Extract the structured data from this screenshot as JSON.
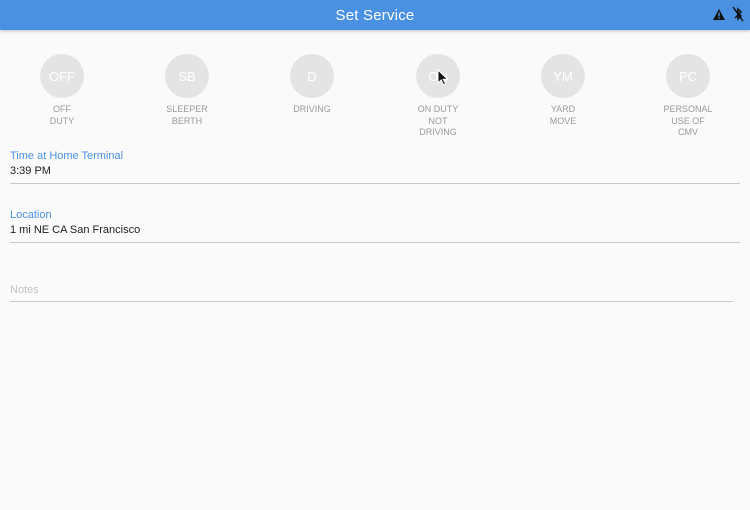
{
  "header": {
    "title": "Set Service"
  },
  "statuses": [
    {
      "code": "OFF",
      "label": "OFF\nDUTY"
    },
    {
      "code": "SB",
      "label": "SLEEPER\nBERTH"
    },
    {
      "code": "D",
      "label": "DRIVING"
    },
    {
      "code": "ON",
      "label": "ON DUTY\nNOT\nDRIVING"
    },
    {
      "code": "YM",
      "label": "YARD\nMOVE"
    },
    {
      "code": "PC",
      "label": "PERSONAL\nUSE OF\nCMV"
    }
  ],
  "form": {
    "time_label": "Time at Home Terminal",
    "time_value": "3:39 PM",
    "location_label": "Location",
    "location_value": "1 mi NE CA San Francisco",
    "notes_placeholder": "Notes"
  },
  "icons": {
    "warning": "warning-icon",
    "bluetooth": "bluetooth-off-icon"
  },
  "colors": {
    "header": "#4b91e2",
    "label_accent": "#4b91e2",
    "status_circle": "#e4e4e4"
  }
}
